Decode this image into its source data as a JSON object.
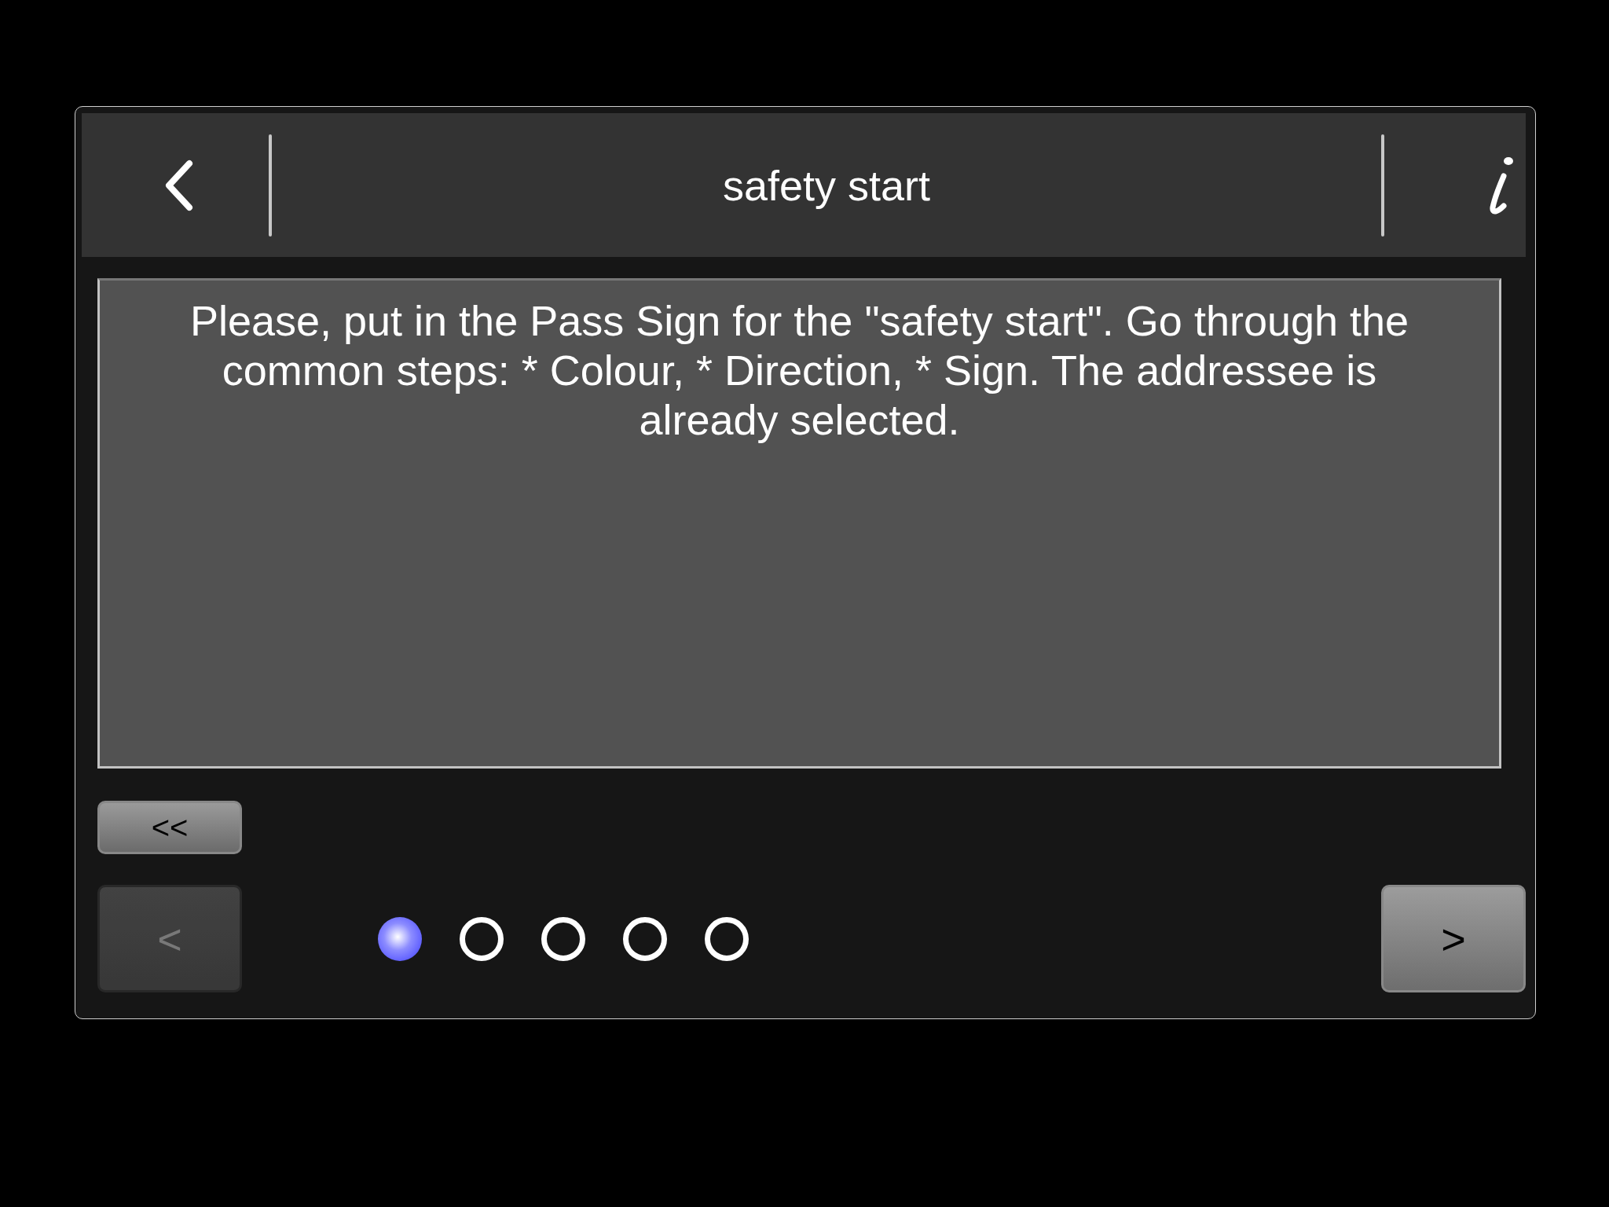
{
  "header": {
    "title": "safety start"
  },
  "message": "Please, put in the Pass Sign for the \"safety start\". Go through the common steps:  * Colour, * Direction, * Sign. The addressee is already selected.",
  "buttons": [
    {
      "kind": "rewind",
      "label": "<<",
      "disabled": false
    },
    {
      "kind": "prev",
      "label": "<",
      "disabled": true
    },
    {
      "kind": "next",
      "label": ">",
      "disabled": false
    }
  ],
  "pages": [
    {
      "selected": true
    },
    {
      "selected": false
    },
    {
      "selected": false
    },
    {
      "selected": false
    },
    {
      "selected": false
    }
  ]
}
